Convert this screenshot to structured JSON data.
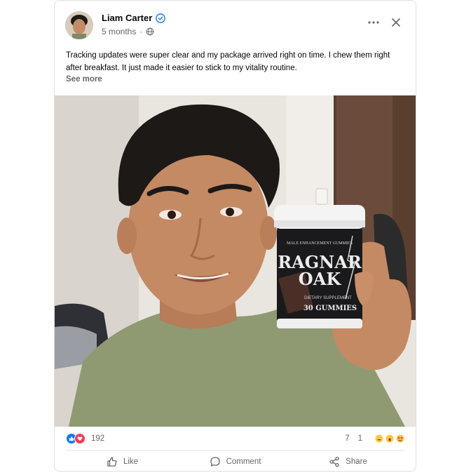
{
  "post": {
    "author": "Liam Carter",
    "verified": true,
    "time": "5 months",
    "audience_icon": "globe-icon",
    "text": "Tracking updates were super clear and my package arrived right on time. I chew them right after breakfast. It just made it easier to stick to my vitality routine.",
    "see_more": "See more"
  },
  "product": {
    "brand_line1": "RAGNAR",
    "brand_line2": "OAK",
    "top_text": "MALE ENHANCEMENT GUMMIES",
    "sub_text": "DIETARY SUPPLEMENT",
    "count_text": "30 GUMMIES"
  },
  "stats": {
    "reactions": "192",
    "comments": "7",
    "shares": "1"
  },
  "actions": {
    "like": "Like",
    "comment": "Comment",
    "share": "Share"
  },
  "colors": {
    "accent": "#1877f2",
    "muted": "#65676b",
    "shirt": "#8f9a73"
  }
}
